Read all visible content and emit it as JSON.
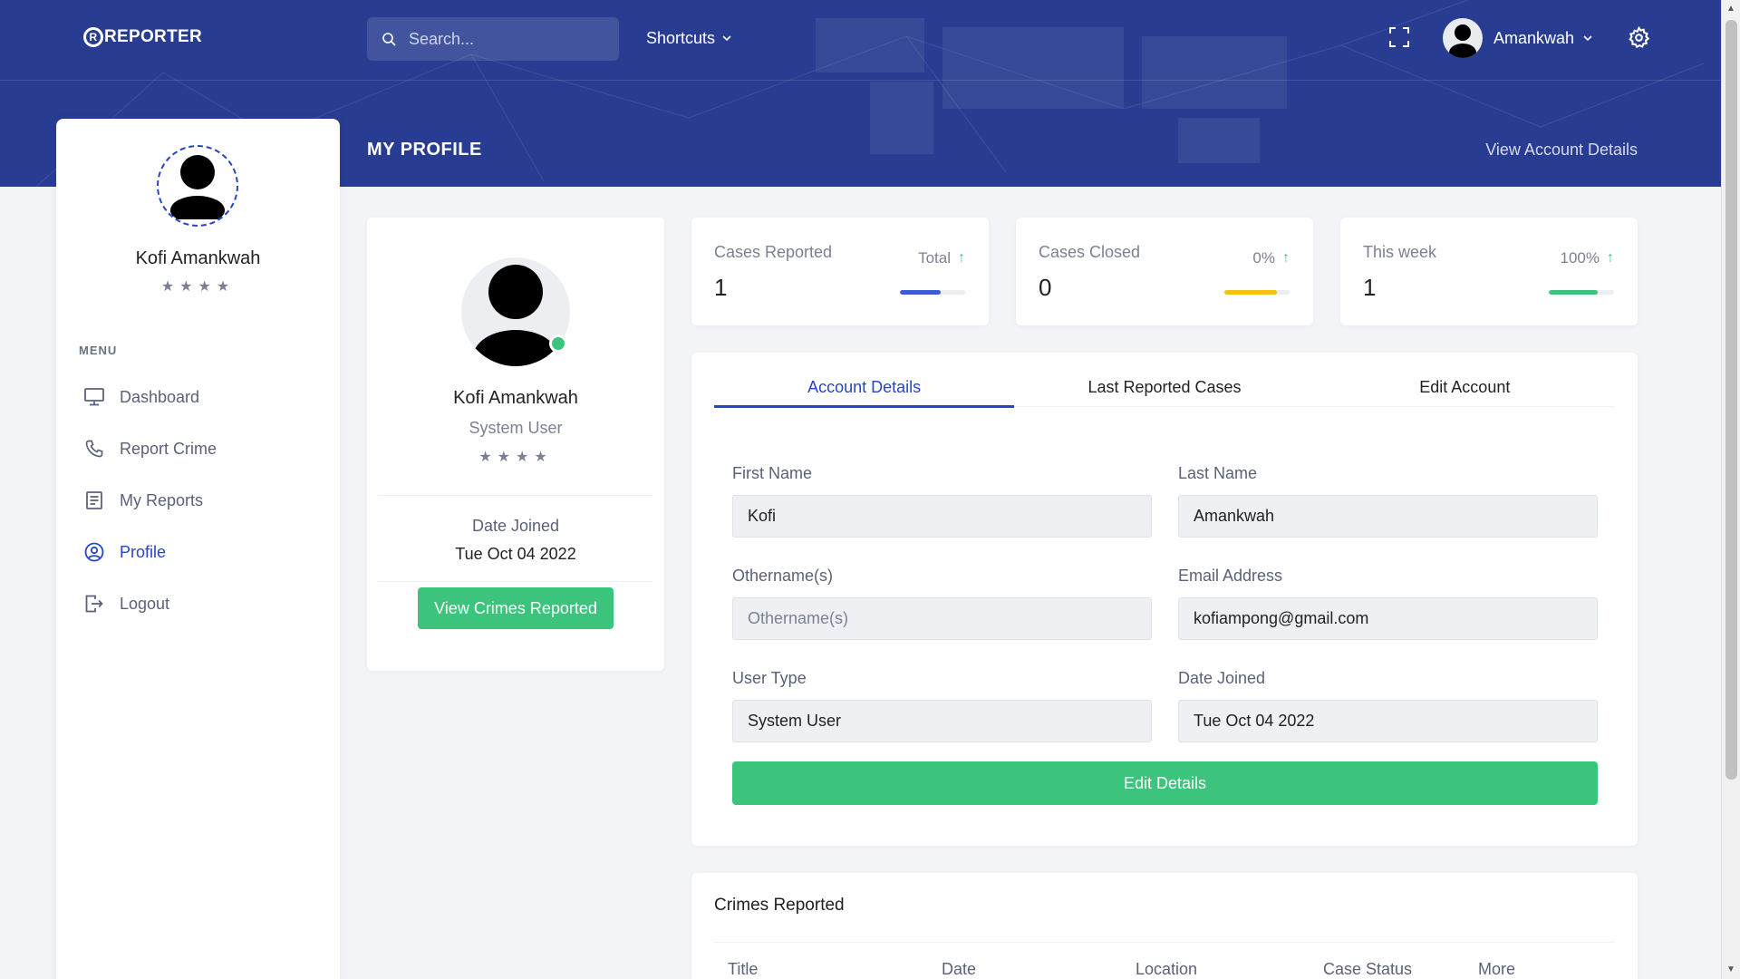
{
  "app": {
    "logo_mark": "R",
    "logo_text": "REPORTER"
  },
  "header": {
    "search_placeholder": "Search...",
    "shortcuts_label": "Shortcuts",
    "user_name": "Amankwah",
    "page_title": "MY PROFILE",
    "view_account_link": "View Account Details"
  },
  "sidebar": {
    "name": "Kofi Amankwah",
    "stars": "★★★★",
    "menu_title": "MENU",
    "items": [
      {
        "label": "Dashboard",
        "icon": "monitor-icon"
      },
      {
        "label": "Report Crime",
        "icon": "phone-icon"
      },
      {
        "label": "My Reports",
        "icon": "document-icon"
      },
      {
        "label": "Profile",
        "icon": "user-circle-icon",
        "active": true
      },
      {
        "label": "Logout",
        "icon": "logout-icon"
      }
    ]
  },
  "profile_card": {
    "name": "Kofi Amankwah",
    "role": "System User",
    "stars": "★★★★",
    "date_joined_label": "Date Joined",
    "date_joined": "Tue Oct 04 2022",
    "button_label": "View Crimes Reported"
  },
  "stats": [
    {
      "label": "Cases Reported",
      "value": "1",
      "trend": "Total",
      "progress": 0.62,
      "color": "#3d5bd9"
    },
    {
      "label": "Cases Closed",
      "value": "0",
      "trend": "0%",
      "progress": 0.8,
      "color": "#f1c40f"
    },
    {
      "label": "This week",
      "value": "1",
      "trend": "100%",
      "progress": 0.75,
      "color": "#3cc47c"
    }
  ],
  "account": {
    "tabs": [
      "Account Details",
      "Last Reported Cases",
      "Edit Account"
    ],
    "active_tab": 0,
    "first_name_label": "First Name",
    "first_name": "Kofi",
    "last_name_label": "Last Name",
    "last_name": "Amankwah",
    "othername_label": "Othername(s)",
    "othername_placeholder": "Othername(s)",
    "email_label": "Email Address",
    "email": "kofiampong@gmail.com",
    "user_type_label": "User Type",
    "user_type": "System User",
    "date_joined_label": "Date Joined",
    "date_joined": "Tue Oct 04 2022",
    "edit_button": "Edit Details"
  },
  "crimes": {
    "title": "Crimes Reported",
    "columns": [
      "Title",
      "Date",
      "Location",
      "Case Status",
      "More"
    ]
  },
  "colors": {
    "header_bg": "#283d91",
    "accent": "#2845c4",
    "success": "#3cc47c"
  }
}
